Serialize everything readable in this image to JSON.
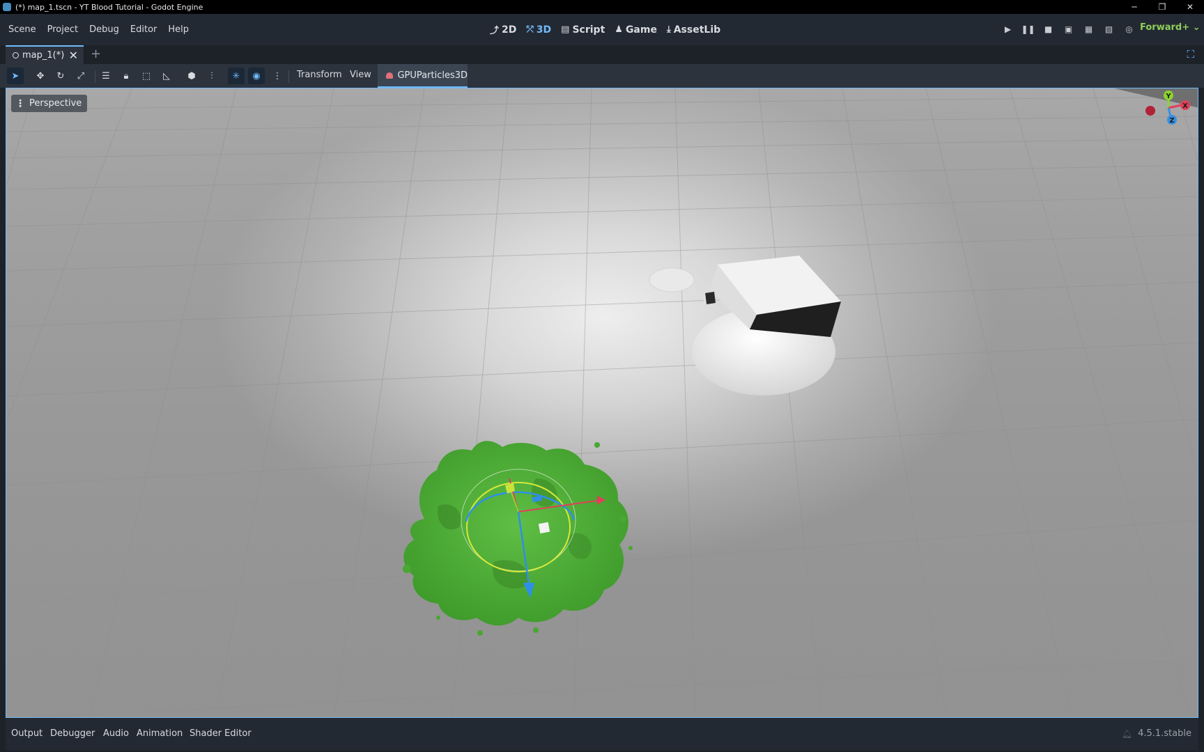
{
  "window": {
    "title": "(*) map_1.tscn - YT Blood Tutorial - Godot Engine",
    "controls": {
      "minimize": "─",
      "restore": "❐",
      "close": "✕"
    }
  },
  "menu": {
    "items": [
      "Scene",
      "Project",
      "Debug",
      "Editor",
      "Help"
    ]
  },
  "workspaces": {
    "items": [
      {
        "label": "2D",
        "icon": "2d-icon"
      },
      {
        "label": "3D",
        "icon": "3d-icon",
        "active": true
      },
      {
        "label": "Script",
        "icon": "script-icon"
      },
      {
        "label": "Game",
        "icon": "game-icon"
      },
      {
        "label": "AssetLib",
        "icon": "assetlib-icon"
      }
    ]
  },
  "run_buttons": [
    "play-icon",
    "pause-icon",
    "stop-icon",
    "remote-debug-icon",
    "play-scene-icon",
    "play-custom-icon",
    "movie-maker-icon"
  ],
  "renderer": {
    "label": "Forward+",
    "color": "#8fcf59"
  },
  "scene_tabs": [
    {
      "label": "map_1(*)",
      "modified": true
    }
  ],
  "toolbar": {
    "transform_label": "Transform",
    "view_label": "View",
    "node_tab_label": "GPUParticles3D",
    "tools": [
      "select-icon",
      "move-icon",
      "rotate-icon",
      "scale-icon",
      "list-select-icon",
      "lock-icon",
      "group-icon",
      "ruler-icon",
      "snap-object-icon",
      "snap-grid-icon",
      "local-space-icon",
      "use-snap-icon",
      "more-icon"
    ]
  },
  "viewport": {
    "perspective_label": "Perspective",
    "gizmo_axes": {
      "y": "Y",
      "x": "X",
      "z": "Z"
    },
    "colors": {
      "x": "#e0405a",
      "y": "#8cd430",
      "z": "#3a8fe0",
      "accent": "#70bafa"
    }
  },
  "bottom_panel": {
    "tabs": [
      "Output",
      "Debugger",
      "Audio",
      "Animation",
      "Shader Editor"
    ],
    "version": "4.5.1.stable"
  }
}
